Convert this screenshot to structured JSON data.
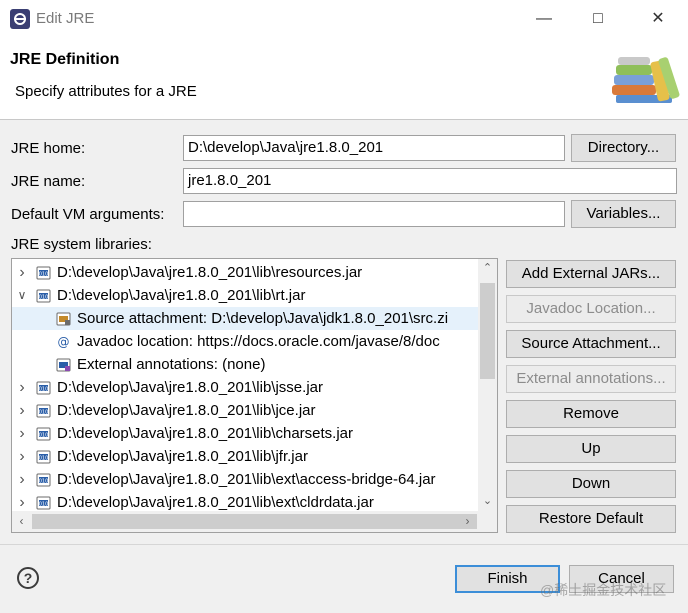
{
  "window": {
    "title": "Edit JRE"
  },
  "header": {
    "title": "JRE Definition",
    "subtitle": "Specify attributes for a JRE"
  },
  "form": {
    "jre_home_label": "JRE home:",
    "jre_home_value": "D:\\develop\\Java\\jre1.8.0_201",
    "directory_button": "Directory...",
    "jre_name_label": "JRE name:",
    "jre_name_value": "jre1.8.0_201",
    "vm_args_label": "Default VM arguments:",
    "vm_args_value": "",
    "variables_button": "Variables...",
    "libraries_label": "JRE system libraries:"
  },
  "tree": {
    "rows": [
      {
        "text": "D:\\develop\\Java\\jre1.8.0_201\\lib\\resources.jar",
        "expander": "collapsed",
        "icon": "jar-icon",
        "level": 0
      },
      {
        "text": "D:\\develop\\Java\\jre1.8.0_201\\lib\\rt.jar",
        "expander": "expanded",
        "icon": "jar-icon",
        "level": 0
      },
      {
        "text": "Source attachment: D:\\develop\\Java\\jdk1.8.0_201\\src.zi",
        "expander": "none",
        "icon": "source-attachment-icon",
        "level": 1,
        "selected": true
      },
      {
        "text": "Javadoc location: https://docs.oracle.com/javase/8/doc",
        "expander": "none",
        "icon": "javadoc-icon",
        "level": 1
      },
      {
        "text": "External annotations: (none)",
        "expander": "none",
        "icon": "annotations-icon",
        "level": 1
      },
      {
        "text": "D:\\develop\\Java\\jre1.8.0_201\\lib\\jsse.jar",
        "expander": "collapsed",
        "icon": "jar-icon",
        "level": 0
      },
      {
        "text": "D:\\develop\\Java\\jre1.8.0_201\\lib\\jce.jar",
        "expander": "collapsed",
        "icon": "jar-icon",
        "level": 0
      },
      {
        "text": "D:\\develop\\Java\\jre1.8.0_201\\lib\\charsets.jar",
        "expander": "collapsed",
        "icon": "jar-icon",
        "level": 0
      },
      {
        "text": "D:\\develop\\Java\\jre1.8.0_201\\lib\\jfr.jar",
        "expander": "collapsed",
        "icon": "jar-icon",
        "level": 0
      },
      {
        "text": "D:\\develop\\Java\\jre1.8.0_201\\lib\\ext\\access-bridge-64.jar",
        "expander": "collapsed",
        "icon": "jar-icon",
        "level": 0
      },
      {
        "text": "D:\\develop\\Java\\jre1.8.0_201\\lib\\ext\\cldrdata.jar",
        "expander": "collapsed",
        "icon": "jar-icon",
        "level": 0
      }
    ]
  },
  "side_buttons": {
    "add_external_jars": "Add External JARs...",
    "javadoc_location": "Javadoc Location...",
    "source_attachment": "Source Attachment...",
    "external_annotations": "External annotations...",
    "remove": "Remove",
    "up": "Up",
    "down": "Down",
    "restore_default": "Restore Default"
  },
  "footer": {
    "finish": "Finish",
    "cancel": "Cancel",
    "help": "?"
  },
  "watermark": "@稀土掘金技术社区",
  "colors": {
    "selection": "#e5f1fb",
    "default_button_border": "#3c8ed8",
    "jar_blue": "#2a5ea8"
  }
}
